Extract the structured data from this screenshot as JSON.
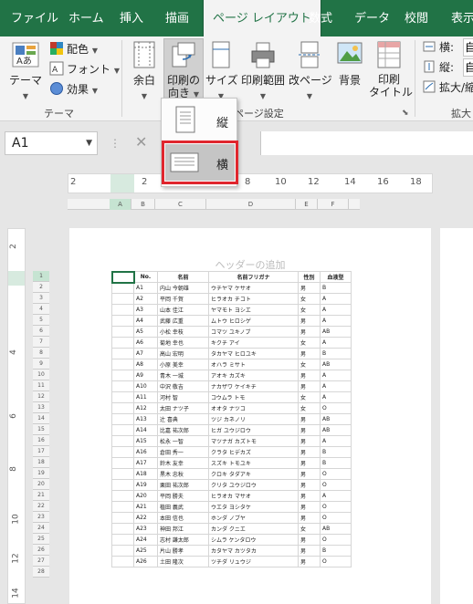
{
  "ribbon_tabs": [
    "ファイル",
    "ホーム",
    "挿入",
    "描画",
    "ページ レイアウト",
    "数式",
    "データ",
    "校閲",
    "表示"
  ],
  "active_tab": "ページ レイアウト",
  "theme_group": {
    "themes_label": "テーマ",
    "colors_label": "配色",
    "fonts_label": "フォント",
    "effects_label": "効果",
    "group_label": "テーマ"
  },
  "page_setup_group": {
    "margins_label": "余白",
    "orientation_label_1": "印刷の",
    "orientation_label_2": "向き",
    "size_label": "サイズ",
    "print_area_label": "印刷範囲",
    "breaks_label": "改ページ",
    "background_label": "背景",
    "print_titles_label_1": "印刷",
    "print_titles_label_2": "タイトル",
    "group_label": "ページ設定"
  },
  "scale_group": {
    "width_label": "横:",
    "width_value": "自",
    "height_label": "縦:",
    "height_value": "自",
    "scale_label": "拡大/縮",
    "group_label": "拡大"
  },
  "orientation_menu": {
    "portrait_label": "縦",
    "landscape_label": "横",
    "selected": "landscape"
  },
  "name_box": "A1",
  "ruler_ticks": [
    "2",
    "2",
    "4",
    "6",
    "8",
    "10",
    "12",
    "14",
    "16",
    "18"
  ],
  "vertical_ruler_ticks": [
    "2",
    "4",
    "6",
    "8",
    "10",
    "12",
    "14",
    "16"
  ],
  "column_headers": [
    "A",
    "B",
    "C",
    "D",
    "E",
    "F"
  ],
  "header_placeholder": "ヘッダーの追加",
  "table_headers": [
    "No.",
    "名前",
    "名前フリガナ",
    "性別",
    "血液型"
  ],
  "rows": [
    [
      "A1",
      "内山 今朝雄",
      "ウチヤマ ケサオ",
      "男",
      "B"
    ],
    [
      "A2",
      "平岡 千賀",
      "ヒラオカ チコト",
      "女",
      "A"
    ],
    [
      "A3",
      "山本 佳江",
      "ヤマモト ヨシエ",
      "女",
      "A"
    ],
    [
      "A4",
      "武藤 広重",
      "ムトウ ヒロシゲ",
      "男",
      "A"
    ],
    [
      "A5",
      "小松 幸枝",
      "コマツ ユキノブ",
      "男",
      "AB"
    ],
    [
      "A6",
      "菊地 幸也",
      "キクチ アイ",
      "女",
      "A"
    ],
    [
      "A7",
      "高山 宏明",
      "タカヤマ ヒロユキ",
      "男",
      "B"
    ],
    [
      "A8",
      "小原 美幸",
      "オハラ ミサト",
      "女",
      "AB"
    ],
    [
      "A9",
      "青木 一城",
      "アオキ カズキ",
      "男",
      "A"
    ],
    [
      "A10",
      "中沢 敬吉",
      "ナカザワ ケイキチ",
      "男",
      "A"
    ],
    [
      "A11",
      "河村 智",
      "コウムラ トモ",
      "女",
      "A"
    ],
    [
      "A12",
      "太田 ナツ子",
      "オオタ ナツコ",
      "女",
      "O"
    ],
    [
      "A13",
      "辻 喜典",
      "ツジ カネノリ",
      "男",
      "AB"
    ],
    [
      "A14",
      "比嘉 祐次郎",
      "ヒガ ユウジロウ",
      "男",
      "AB"
    ],
    [
      "A15",
      "松永 一智",
      "マツナガ カズトモ",
      "男",
      "A"
    ],
    [
      "A16",
      "倉田 秀一",
      "クラタ ヒデカズ",
      "男",
      "B"
    ],
    [
      "A17",
      "鈴木 友幸",
      "スズキ トモユキ",
      "男",
      "B"
    ],
    [
      "A18",
      "黒木 忠秋",
      "クロキ タダアキ",
      "男",
      "O"
    ],
    [
      "A19",
      "栗田 祐次郎",
      "クリタ ユウジロウ",
      "男",
      "O"
    ],
    [
      "A20",
      "平岡 勝夫",
      "ヒラオカ マサオ",
      "男",
      "A"
    ],
    [
      "A21",
      "植田 義武",
      "ウエタ ヨシタケ",
      "男",
      "O"
    ],
    [
      "A22",
      "本田 信也",
      "ホンダ ノブヤ",
      "男",
      "O"
    ],
    [
      "A23",
      "神田 邦江",
      "カンダ クニエ",
      "女",
      "AB"
    ],
    [
      "A24",
      "志村 謙太郎",
      "シムラ ケンタロウ",
      "男",
      "O"
    ],
    [
      "A25",
      "片山 勝孝",
      "カタヤマ カツタカ",
      "男",
      "B"
    ],
    [
      "A26",
      "土田 隆次",
      "ツチダ リュウジ",
      "男",
      "O"
    ]
  ],
  "row_numbers": [
    "1",
    "2",
    "3",
    "4",
    "5",
    "6",
    "7",
    "8",
    "9",
    "10",
    "11",
    "12",
    "13",
    "14",
    "15",
    "16",
    "17",
    "18",
    "19",
    "20",
    "21",
    "22",
    "23",
    "24",
    "25",
    "26",
    "27",
    "28"
  ],
  "colors": {
    "accent": "#217346",
    "highlight": "#e0262e"
  }
}
